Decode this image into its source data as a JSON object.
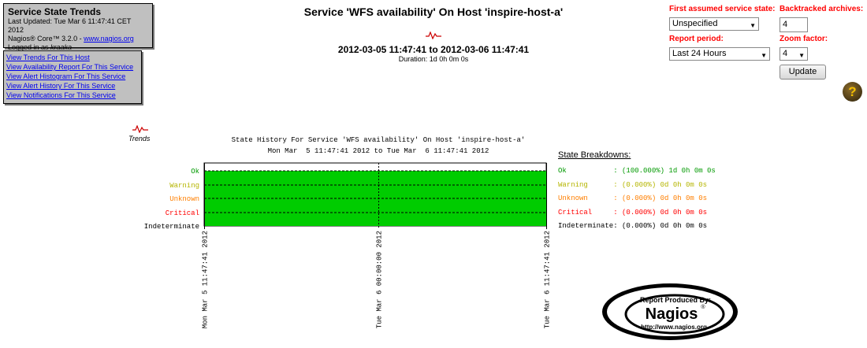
{
  "info": {
    "title": "Service State Trends",
    "updated": "Last Updated: Tue Mar 6 11:47:41 CET 2012",
    "core_prefix": "Nagios® Core™ 3.2.0 - ",
    "core_link": "www.nagios.org",
    "logged_prefix": "Logged in as ",
    "user": "kraaka"
  },
  "links": [
    "View Trends For This Host",
    "View Availability Report For This Service",
    "View Alert Histogram For This Service",
    "View Alert History For This Service",
    "View Notifications For This Service"
  ],
  "header": {
    "title": "Service 'WFS availability' On Host 'inspire-host-a'",
    "date_range": "2012-03-05 11:47:41 to 2012-03-06 11:47:41",
    "duration": "Duration: 1d 0h 0m 0s"
  },
  "options": {
    "first_state_label": "First assumed service state:",
    "first_state_value": "Unspecified",
    "backtracked_label": "Backtracked archives:",
    "backtracked_value": "4",
    "report_period_label": "Report period:",
    "report_period_value": "Last 24 Hours",
    "zoom_label": "Zoom factor:",
    "zoom_value": "4",
    "update_label": "Update"
  },
  "trends_label": "Trends",
  "chart_data": {
    "type": "area",
    "title": "State History For Service 'WFS availability' On Host 'inspire-host-a'",
    "subtitle": "Mon Mar  5 11:47:41 2012 to Tue Mar  6 11:47:41 2012",
    "states": [
      {
        "name": "Ok",
        "color": "#009900"
      },
      {
        "name": "Warning",
        "color": "#b5b500"
      },
      {
        "name": "Unknown",
        "color": "#ff7f00"
      },
      {
        "name": "Critical",
        "color": "#ff0000"
      },
      {
        "name": "Indeterminate",
        "color": "#000000"
      }
    ],
    "x_ticks": [
      {
        "label": "Mon Mar  5 11:47:41 2012",
        "hours": 0
      },
      {
        "label": "Tue Mar  6 00:00:00 2012",
        "hours": 12.2053
      },
      {
        "label": "Tue Mar  6 11:47:41 2012",
        "hours": 24
      }
    ],
    "x_range_hours": [
      0,
      24
    ],
    "segments": [
      {
        "state": "Ok",
        "start_hours": 0,
        "end_hours": 24
      }
    ],
    "fill_color": "#00cc00"
  },
  "breakdown": {
    "title": "State Breakdowns:",
    "rows": [
      {
        "label": "Ok           : (100.000%) 1d 0h 0m 0s",
        "color": "#009900"
      },
      {
        "label": "Warning      : (0.000%) 0d 0h 0m 0s",
        "color": "#b5b500"
      },
      {
        "label": "Unknown      : (0.000%) 0d 0h 0m 0s",
        "color": "#ff7f00"
      },
      {
        "label": "Critical     : (0.000%) 0d 0h 0m 0s",
        "color": "#ff0000"
      },
      {
        "label": "Indeterminate: (0.000%) 0d 0h 0m 0s",
        "color": "#000000"
      }
    ]
  },
  "badge": {
    "line1": "Report Produced By:",
    "brand": "Nagios",
    "url": "http://www.nagios.org"
  }
}
